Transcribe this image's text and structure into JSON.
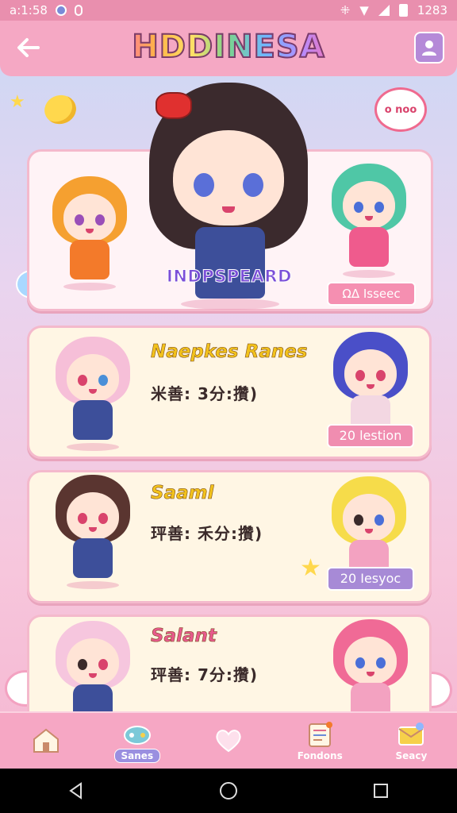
{
  "status_bar": {
    "time": "a:1:58",
    "battery_text": "1283"
  },
  "app_bar": {
    "title": "HDDINESA"
  },
  "deco": {
    "speech_text": "o noo"
  },
  "hero": {
    "sign_text": "INDPSPEARD",
    "badge": "ΩΔ Isseec"
  },
  "cards": [
    {
      "title": "Naepkes Ranes",
      "stat": "米善: 3分:攢)",
      "badge": "20 lestion",
      "title_color": "#f2c21c",
      "badge_color": "#f08db0"
    },
    {
      "title": "Saaml",
      "stat": "玶善: 禾分:攢)",
      "badge": "20 Iesyoc",
      "title_color": "#f2c21c",
      "badge_color": "#a78ad6"
    },
    {
      "title": "Salant",
      "stat": "玶善: 7分:攢)",
      "badge": "",
      "title_color": "#e75a8d",
      "badge_color": "#f08db0"
    }
  ],
  "bottom_nav": [
    {
      "label": "",
      "icon": "house-icon"
    },
    {
      "label": "Sanes",
      "icon": "game-controller-icon"
    },
    {
      "label": "",
      "icon": "heart-icon"
    },
    {
      "label": "Fondons",
      "icon": "book-icon"
    },
    {
      "label": "Seacy",
      "icon": "mail-icon"
    }
  ],
  "colors": {
    "accent": "#f5a8c4",
    "card_bg": "#fff6e4",
    "card_border": "#f4b9cc"
  }
}
